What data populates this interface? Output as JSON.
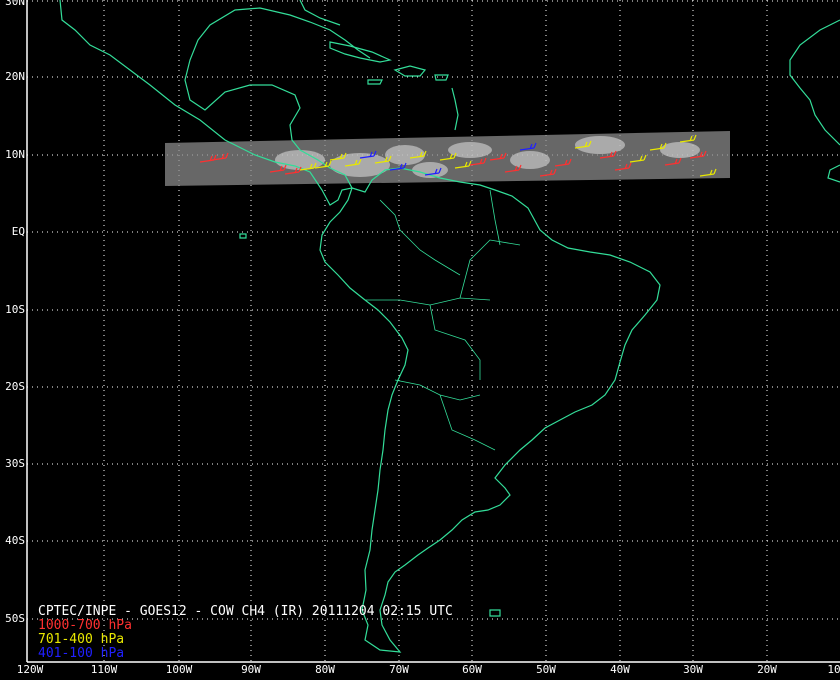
{
  "title": "CPTEC/INPE - GOES12 - COW CH4 (IR) 20111204 02:15 UTC",
  "legend": [
    {
      "label": "1000-700 hPa",
      "color": "#ff3030"
    },
    {
      "label": "701-400 hPa",
      "color": "#e8e800"
    },
    {
      "label": "401-100 hPa",
      "color": "#2020ff"
    }
  ],
  "lat_labels": [
    "30N",
    "20N",
    "10N",
    "EQ",
    "10S",
    "20S",
    "30S",
    "40S",
    "50S"
  ],
  "lon_labels": [
    "120W",
    "110W",
    "100W",
    "90W",
    "80W",
    "70W",
    "60W",
    "50W",
    "40W",
    "30W",
    "20W",
    "10"
  ],
  "colors": {
    "coastline": "#33dd99",
    "grid": "#ffffff",
    "background": "#000000"
  }
}
